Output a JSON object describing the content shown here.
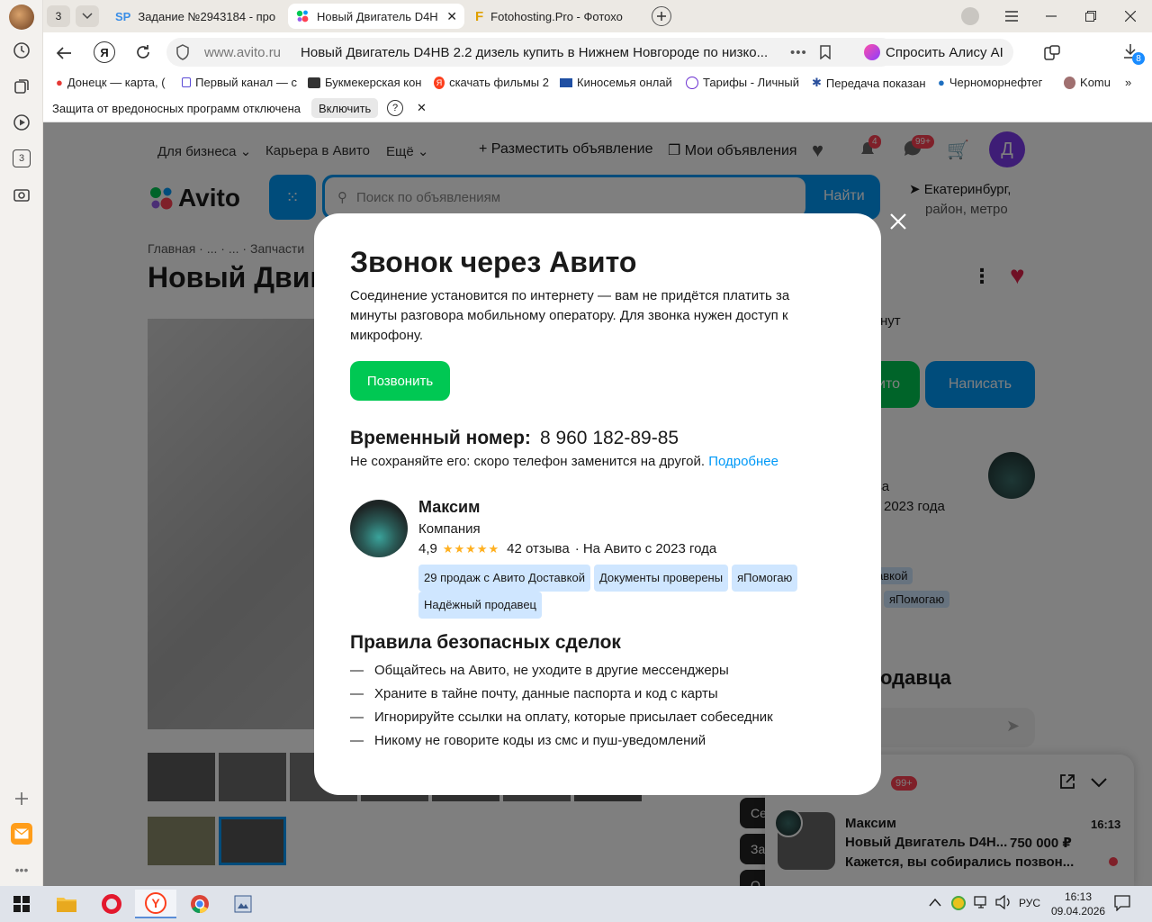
{
  "tabs": {
    "counter": "3",
    "items": [
      {
        "icon": "sp-icon",
        "label": "Задание №2943184 - про"
      },
      {
        "icon": "avito-icon",
        "label": "Новый Двигатель D4H"
      },
      {
        "icon": "fotohosting-icon",
        "label": "Fotohosting.Pro - Фотохо"
      }
    ]
  },
  "address": {
    "domain": "www.avito.ru",
    "title": "Новый Двигатель D4HB 2.2 дизель купить в Нижнем Новгороде по низко...",
    "alisa": "Спросить Алису AI",
    "downloads_badge": "8"
  },
  "bookmarks": [
    "Донецк — карта, (",
    "Первый канал — с",
    "Букмекерская кон",
    "скачать фильмы 2",
    "Киносемья онлай",
    "Тарифы - Личный",
    "Передача показан",
    "Черноморнефтег",
    "Komu"
  ],
  "infobar": {
    "text": "Защита от вредоносных программ отключена",
    "button": "Включить",
    "help": "?"
  },
  "page": {
    "nav": {
      "business": "Для бизнеса",
      "career": "Карьера в Авито",
      "more": "Ещё",
      "post_ad": "Разместить объявление",
      "my_ads": "Мои объявления",
      "notif_badge": "4",
      "msg_badge": "99+",
      "avatar_letter": "Д"
    },
    "logo": "Avito",
    "search_placeholder": "Поиск по объявлениям",
    "search_button": "Найти",
    "location_line1": "Екатеринбург,",
    "location_line2": "район, метро",
    "breadcrumb": {
      "home": "Главная",
      "d1": "...",
      "d2": "...",
      "parts": "Запчасти"
    },
    "title_partial": "Новый Двиг",
    "right_text_nut": "нут",
    "show_phone_partial": "ито",
    "write_button": "Написать",
    "seller_partial1": "ва",
    "seller_partial2": "2023 года",
    "chip_partial": "авкой",
    "chip_ya": "яПомогаю",
    "seller_heading_partial": "одавца",
    "side_buttons": [
      "Се",
      "За",
      "О"
    ]
  },
  "chat": {
    "title_partial": "ия",
    "badge": "99+",
    "name": "Максим",
    "time": "16:13",
    "item": "Новый Двигатель D4H...",
    "price": "750 000 ₽",
    "message": "Кажется, вы собирались позвон..."
  },
  "modal": {
    "title": "Звонок через Авито",
    "description": "Соединение установится по интернету — вам не придётся платить за минуты разговора мобильному оператору. Для звонка нужен доступ к микрофону.",
    "call_button": "Позвонить",
    "temp_number_label": "Временный номер:",
    "temp_number": "8 960 182-89-85",
    "warning": "Не сохраняйте его: скоро телефон заменится на другой.",
    "more_link": "Подробнее",
    "seller": {
      "name": "Максим",
      "type": "Компания",
      "rating": "4,9",
      "rating_value": 4.9,
      "reviews": "42 отзыва",
      "since": "· На Авито с 2023 года",
      "badges": [
        "29 продаж с Авито Доставкой",
        "Документы проверены",
        "яПомогаю",
        "Надёжный продавец"
      ]
    },
    "rules_title": "Правила безопасных сделок",
    "rules": [
      "Общайтесь на Авито, не уходите в другие мессенджеры",
      "Храните в тайне почту, данные паспорта и код с карты",
      "Игнорируйте ссылки на оплату, которые присылает собеседник",
      "Никому не говорите коды из смс и пуш-уведомлений"
    ]
  },
  "taskbar": {
    "lang": "РУС",
    "time": "16:13",
    "date": "09.04.2026"
  },
  "colors": {
    "avito_blue": "#0099f7",
    "avito_green": "#00c853",
    "link": "#0099f7",
    "chip_bg": "#cfe6ff"
  }
}
